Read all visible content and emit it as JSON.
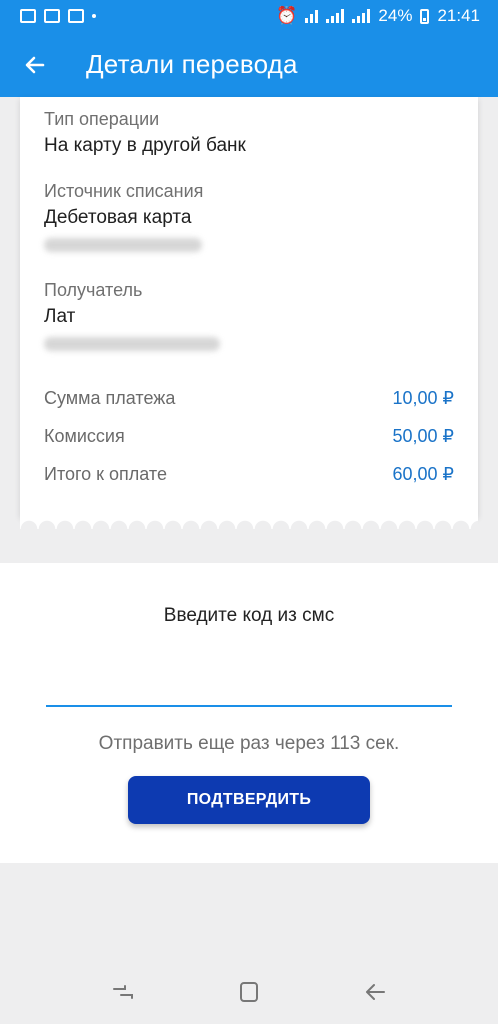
{
  "status_bar": {
    "battery": "24%",
    "time": "21:41"
  },
  "header": {
    "title": "Детали перевода",
    "back_icon": "arrow-left-icon"
  },
  "details": {
    "operation_type_label": "Тип операции",
    "operation_type_value": "На карту в другой банк",
    "source_label": "Источник списания",
    "source_value": "Дебетовая карта",
    "recipient_label": "Получатель",
    "recipient_value": "Лат"
  },
  "amounts": [
    {
      "label": "Сумма платежа",
      "value": "10,00 ₽"
    },
    {
      "label": "Комиссия",
      "value": "50,00 ₽"
    },
    {
      "label": "Итого к оплате",
      "value": "60,00 ₽"
    }
  ],
  "sms": {
    "title": "Введите код из смс",
    "input_value": "",
    "resend_text": "Отправить еще раз через 113 сек.",
    "confirm_label": "ПОДТВЕРДИТЬ"
  },
  "colors": {
    "app_bar": "#1a8fe8",
    "accent_value": "#1a73c8",
    "confirm_button": "#0d3ab1"
  }
}
